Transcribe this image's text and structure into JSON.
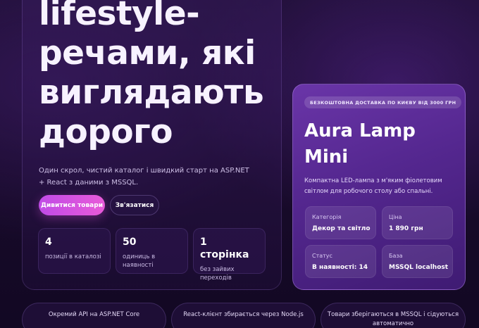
{
  "hero": {
    "headline_lines": [
      "lifestyle-",
      "речами, які",
      "виглядають",
      "дорого"
    ],
    "lead": "Один скрол, чистий каталог і швидкий старт на ASP.NET + React з даними з MSSQL.",
    "primary_button": "Дивитися товари",
    "secondary_button": "Зв'язатися",
    "stats": [
      {
        "value": "4",
        "label": "позиції в каталозі"
      },
      {
        "value": "50",
        "label": "одиниць в наявності"
      },
      {
        "value": "1 сторінка",
        "label": "без зайвих переходів"
      }
    ]
  },
  "product": {
    "badge": "БЕЗКОШТОВНА ДОСТАВКА ПО КИЄВУ ВІД 3000 ГРН",
    "title": "Aura Lamp Mini",
    "description": "Компактна LED-лампа з м'яким фіолетовим світлом для робочого столу або спальні.",
    "info": [
      {
        "key": "Категорія",
        "value": "Декор та світло"
      },
      {
        "key": "Ціна",
        "value": "1 890 грн"
      },
      {
        "key": "Статус",
        "value": "В наявності: 14"
      },
      {
        "key": "База",
        "value": "MSSQL localhost"
      }
    ]
  },
  "features": [
    "Окремий API на ASP.NET Core",
    "React-клієнт збирається через Node.js",
    "Товари зберігаються в MSSQL і сідуються автоматично"
  ],
  "colors": {
    "background": "#170a29",
    "accent_gradient_start": "#c04be6",
    "accent_gradient_end": "#e85ad9",
    "product_card": "#54278f"
  }
}
